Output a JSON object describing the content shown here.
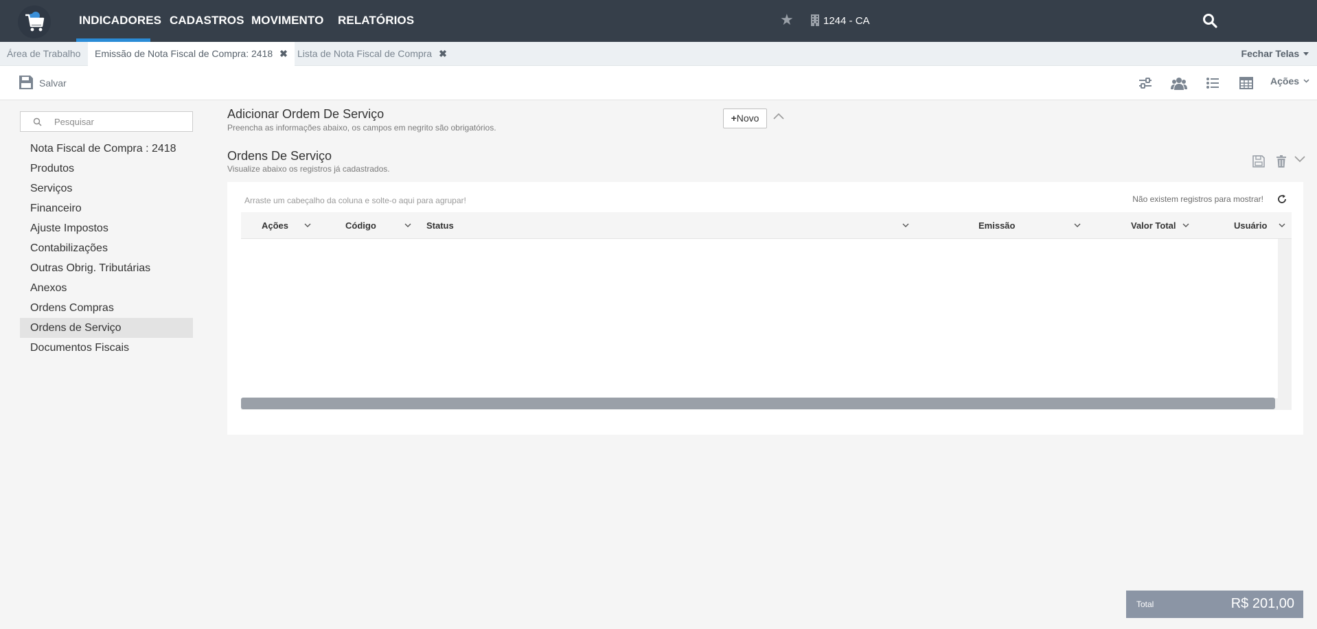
{
  "topnav": {
    "items": [
      "INDICADORES",
      "CADASTROS",
      "MOVIMENTO",
      "RELATÓRIOS"
    ],
    "active": "INDICADORES",
    "company": "1244 - CA"
  },
  "tabs": {
    "items": [
      {
        "label": "Área de Trabalho",
        "closable": false
      },
      {
        "label": "Emissão de Nota Fiscal de Compra: 2418",
        "closable": true
      },
      {
        "label": "Lista de Nota Fiscal de Compra",
        "closable": true
      }
    ],
    "close_glyph": "✖",
    "close_all_label": "Fechar Telas"
  },
  "toolbar": {
    "save_label": "Salvar",
    "actions_label": "Ações"
  },
  "sidebar": {
    "search_placeholder": "Pesquisar",
    "items": [
      "Nota Fiscal de Compra : 2418",
      "Produtos",
      "Serviços",
      "Financeiro",
      "Ajuste Impostos",
      "Contabilizações",
      "Outras Obrig. Tributárias",
      "Anexos",
      "Ordens Compras",
      "Ordens de Serviço",
      "Documentos Fiscais"
    ],
    "selected": "Ordens de Serviço"
  },
  "add_section": {
    "title": "Adicionar Ordem De Serviço",
    "subtitle": "Preencha as informações abaixo, os campos em negrito são obrigatórios.",
    "new_button": "Novo"
  },
  "list_section": {
    "title": "Ordens De Serviço",
    "subtitle": "Visualize abaixo os registros já cadastrados."
  },
  "grid": {
    "group_hint": "Arraste um cabeçalho da coluna e solte-o aqui para agrupar!",
    "no_records": "Não existem registros para mostrar!",
    "columns": [
      "Ações",
      "Código",
      "Status",
      "Emissão",
      "Valor Total",
      "Usuário"
    ],
    "rows": []
  },
  "footer": {
    "total_label": "Total",
    "total_value": "R$ 201,00"
  },
  "colors": {
    "topbar": "#363f4a",
    "active_underline": "#2a8bd6",
    "total_box": "#8b95a5"
  }
}
